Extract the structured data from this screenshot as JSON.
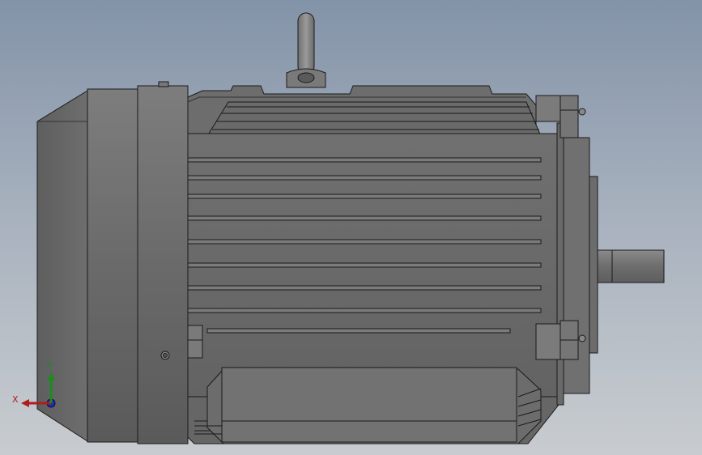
{
  "viewport": {
    "background_top": "#8393a8",
    "background_bottom": "#c8ccd0"
  },
  "model": {
    "body_color": "#6b6b6b",
    "edge_color": "#1a1a1a",
    "cooling_fin_count": 8,
    "components": [
      "fan-cover",
      "end-shield",
      "lifting-eye",
      "frame-body",
      "cooling-fins",
      "terminal-box",
      "terminal-box-lid",
      "mounting-feet",
      "front-flange",
      "shaft",
      "bolt-heads"
    ]
  },
  "triad": {
    "x_label": "X",
    "y_label": "Y",
    "x_color": "#b01c1c",
    "y_color": "#1f8a1f",
    "z_color": "#1e2fa8"
  }
}
